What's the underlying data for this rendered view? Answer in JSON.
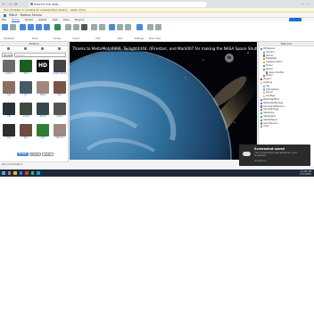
{
  "browser": {
    "nav_glyphs": "← → ⟳",
    "url": "Search the web...",
    "right_glyphs": "☆ ⋯",
    "infobar": "Your browser is running an unsupported version · Learn more"
  },
  "studio": {
    "title": "RBLX - Roblox Studio",
    "menu": [
      "File",
      "Home",
      "Model",
      "Avatar",
      "Test",
      "View",
      "Plugins"
    ],
    "active_menu": "Home",
    "ribbon_groups": [
      {
        "label": "Clipboard"
      },
      {
        "label": "Tools"
      },
      {
        "label": "Terrain"
      },
      {
        "label": "Insert"
      },
      {
        "label": "Edit"
      },
      {
        "label": "Test"
      },
      {
        "label": "Settings"
      },
      {
        "label": "Team Test"
      }
    ]
  },
  "toolbox": {
    "title": "Toolbox",
    "dropdown": "Models",
    "search_placeholder": "Search",
    "items": [
      {
        "label": "Avatar",
        "color": "#6a6a6a"
      },
      {
        "label": "Tree",
        "color": "#1b5e20"
      },
      {
        "label": "HD",
        "color": "#111111"
      },
      {
        "label": "Avatar Model",
        "color": "#444444"
      },
      {
        "label": "Cart",
        "color": "#8d6e63"
      },
      {
        "label": "Jet",
        "color": "#455a64"
      },
      {
        "label": "Table",
        "color": "#a1887f"
      },
      {
        "label": "Sign",
        "color": "#795548"
      },
      {
        "label": "Hat",
        "color": "#263238"
      },
      {
        "label": "Knight",
        "color": "#3e4a3e"
      },
      {
        "label": "Robot",
        "color": "#37474f"
      },
      {
        "label": "Avatar",
        "color": "#555555"
      },
      {
        "label": "Sofa",
        "color": "#2e2e2e"
      },
      {
        "label": "Box",
        "color": "#6d4c41"
      },
      {
        "label": "Ball",
        "color": "#2e7d32"
      },
      {
        "label": "Bench",
        "color": "#a1887f"
      }
    ],
    "pills": [
      "Models",
      "Meshes",
      "Audio"
    ],
    "footer": "Run a command"
  },
  "viewport": {
    "caption": "Thanks to MeltoMoto9999, Twilight4444, 0Firestarr, and Mark007 for making the NASA Space Shuttle!"
  },
  "explorer": {
    "title": "Explorer",
    "rows": [
      {
        "label": "Workspace",
        "color": "#4a89d8"
      },
      {
        "label": "Camera",
        "color": "#888888"
      },
      {
        "label": "Terrain",
        "color": "#3e8e41"
      },
      {
        "label": "Baseplate",
        "color": "#9e9e9e"
      },
      {
        "label": "SpawnLocation",
        "color": "#e0a020"
      },
      {
        "label": "Model",
        "color": "#607d8b"
      },
      {
        "label": "Model",
        "color": "#607d8b"
      },
      {
        "label": "Space Shuttle",
        "color": "#607d8b"
      },
      {
        "label": "Model",
        "color": "#607d8b"
      },
      {
        "label": "Players",
        "color": "#c62828"
      },
      {
        "label": "Lighting",
        "color": "#fbc02d"
      },
      {
        "label": "Sky",
        "color": "#4fc3f7"
      },
      {
        "label": "Atmosphere",
        "color": "#4fc3f7"
      },
      {
        "label": "Bloom",
        "color": "#ffb74d"
      },
      {
        "label": "SunRays",
        "color": "#ffb74d"
      },
      {
        "label": "ReplicatedFirst",
        "color": "#7e57c2"
      },
      {
        "label": "ReplicatedStorage",
        "color": "#7e57c2"
      },
      {
        "label": "ServerScriptService",
        "color": "#5c6bc0"
      },
      {
        "label": "ServerStorage",
        "color": "#5c6bc0"
      },
      {
        "label": "StarterGui",
        "color": "#26a69a"
      },
      {
        "label": "StarterPack",
        "color": "#26a69a"
      },
      {
        "label": "StarterPlayer",
        "color": "#26a69a"
      },
      {
        "label": "SoundService",
        "color": "#ef6c00"
      },
      {
        "label": "Chat",
        "color": "#42a5f5"
      }
    ]
  },
  "toast": {
    "title": "Screenshot saved",
    "body": "The screenshot was added to your OneDrive.",
    "link": "OneDrive"
  },
  "taskbar": {
    "time": "11:06 AM",
    "date": "7/17/2022"
  }
}
